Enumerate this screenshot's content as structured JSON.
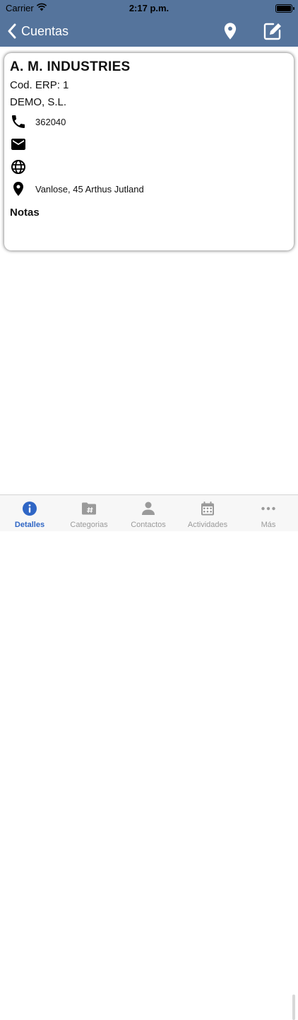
{
  "status": {
    "carrier": "Carrier",
    "time": "2:17 p.m."
  },
  "nav": {
    "back_label": "Cuentas",
    "location_icon": "map-pin-icon",
    "edit_icon": "edit-icon"
  },
  "account": {
    "name": "A. M. INDUSTRIES",
    "erp_code": "Cod. ERP: 1",
    "legal_name": "DEMO, S.L.",
    "phone": "362040",
    "email": "",
    "website": "",
    "address": "Vanlose, 45 Arthus Jutland",
    "notes_label": "Notas"
  },
  "tabs": [
    {
      "label": "Detalles",
      "icon": "info-icon",
      "active": true
    },
    {
      "label": "Categorias",
      "icon": "folder-hash-icon",
      "active": false
    },
    {
      "label": "Contactos",
      "icon": "person-icon",
      "active": false
    },
    {
      "label": "Actividades",
      "icon": "calendar-icon",
      "active": false
    },
    {
      "label": "Más",
      "icon": "more-icon",
      "active": false
    }
  ],
  "colors": {
    "header": "#55749c",
    "accent": "#2f66c5",
    "inactive": "#9a9a9a"
  }
}
